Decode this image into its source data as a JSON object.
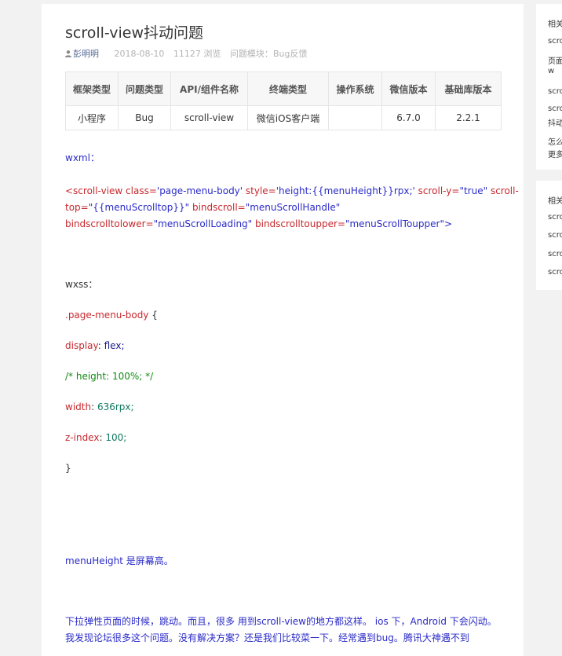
{
  "article": {
    "title": "scroll-view抖动问题",
    "author": "彭明明",
    "date": "2018-08-10",
    "views": "11127 浏览",
    "module_label": "问题模块：",
    "module": "Bug反馈"
  },
  "info_table": {
    "headers": [
      "框架类型",
      "问题类型",
      "API/组件名称",
      "终端类型",
      "操作系统",
      "微信版本",
      "基础库版本"
    ],
    "row": [
      "小程序",
      "Bug",
      "scroll-view",
      "微信iOS客户端",
      "",
      "6.7.0",
      "2.2.1"
    ]
  },
  "content": {
    "wxml_label": "wxml：",
    "code_l1_a": "<scroll-view ",
    "code_l1_b": "class=",
    "code_l1_c": "'page-menu-body' ",
    "code_l1_d": "style=",
    "code_l1_e": "'height:{{menuHeight}}rpx;' ",
    "code_l1_f": "scroll-y=",
    "code_l1_g": "\"true\" ",
    "code_l1_h": "scroll-",
    "code_l2_a": "top=",
    "code_l2_b": "\"{{menuScrolltop}}\" ",
    "code_l2_c": "bindscroll=",
    "code_l2_d": "\"menuScrollHandle\"",
    "code_l3_a": "bindscrolltolower=",
    "code_l3_b": "\"menuScrollLoading\" ",
    "code_l3_c": "bindscrolltoupper=",
    "code_l3_d": "\"menuScrollToupper\">",
    "wxss_label": "wxss：",
    "selector": ".page-menu-body",
    "brace_open": " {",
    "display_prop": "display",
    "display_val": " flex;",
    "comment": "/* height: 100%; */",
    "width_prop": "width",
    "width_val": " 636rpx;",
    "zindex_prop": "z-index",
    "zindex_val": " 100;",
    "brace_close": "}",
    "menu_height_note": "menuHeight 是屏幕高。",
    "para_1": "下拉弹性页面的时候，跳动。而且，很多 用到scroll-view的地方都这样。  ios 下，Android 下会闪动。",
    "para_2": "我发现论坛很多这个问题。没有解决方案？还是我们比较菜一下。经常遇到bug。腾讯大神遇不到"
  },
  "sidebar": {
    "box1": [
      "相关",
      "scro",
      "页面",
      "w",
      "scro",
      "scro",
      "抖动",
      "怎么",
      "更多"
    ],
    "box2": [
      "相关",
      "scro",
      "scro",
      "scro",
      "scro"
    ]
  }
}
